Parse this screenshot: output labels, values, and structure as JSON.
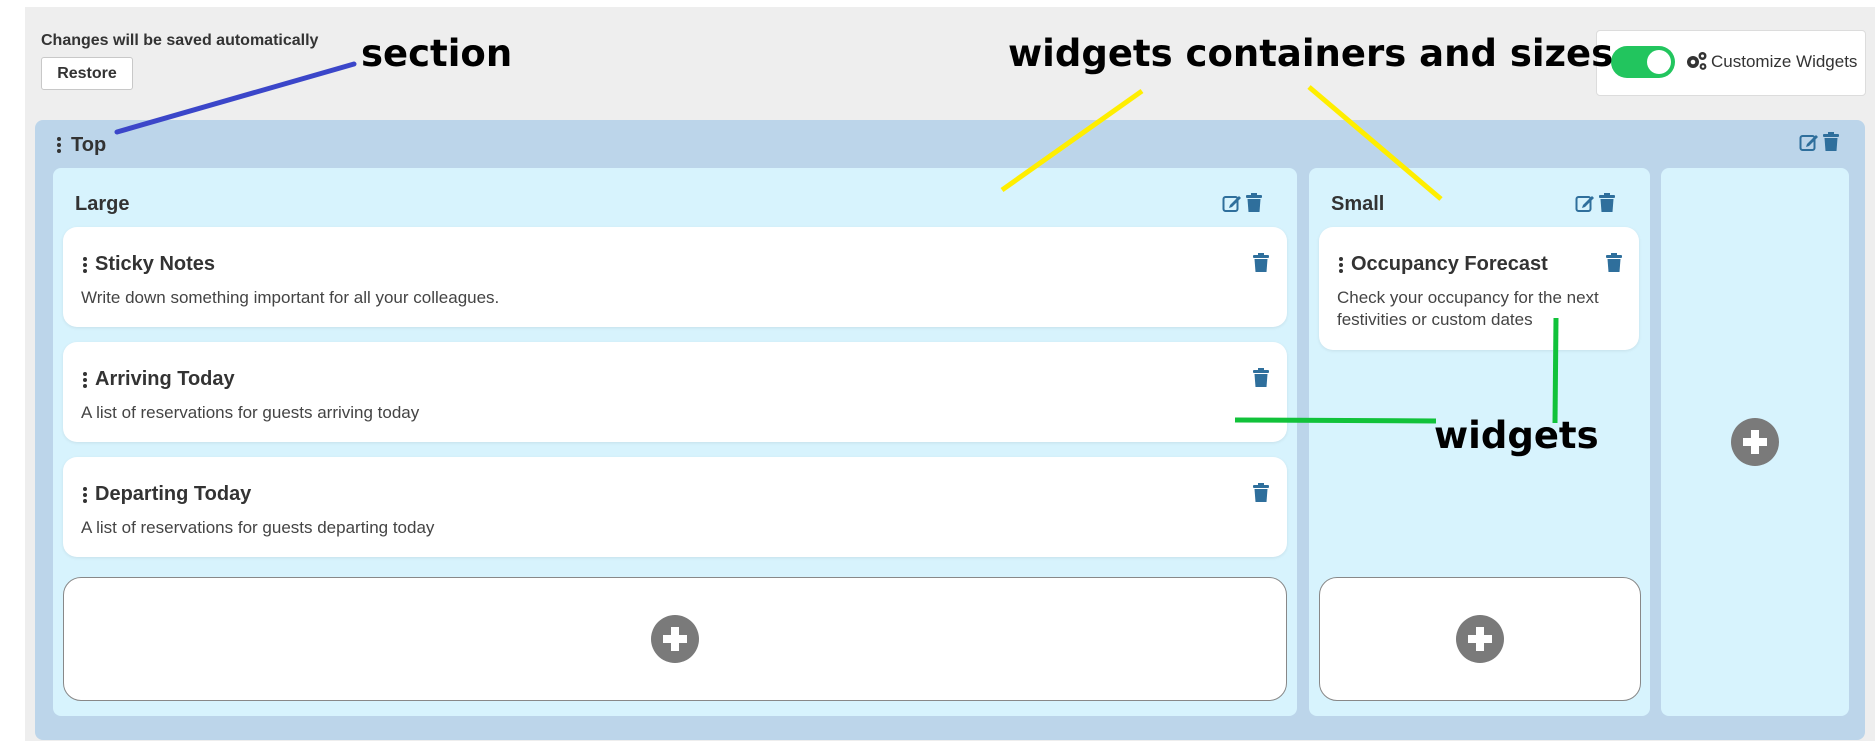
{
  "header": {
    "autosave_note": "Changes will be saved automatically",
    "restore_label": "Restore",
    "customize_label": "Customize Widgets",
    "customize_enabled": true
  },
  "section": {
    "title": "Top",
    "containers": [
      {
        "title": "Large",
        "widgets": [
          {
            "title": "Sticky Notes",
            "description": "Write down something important for all your colleagues."
          },
          {
            "title": "Arriving Today",
            "description": "A list of reservations for guests arriving today"
          },
          {
            "title": "Departing Today",
            "description": "A list of reservations for guests departing today"
          }
        ]
      },
      {
        "title": "Small",
        "widgets": [
          {
            "title": "Occupancy Forecast",
            "description_lines": [
              "Check your occupancy for the next",
              "festivities or custom dates"
            ]
          }
        ]
      }
    ]
  },
  "annotations": {
    "section": "section",
    "containers": "widgets containers and sizes",
    "widgets": "widgets"
  },
  "colors": {
    "toggle_on": "#22c55e",
    "section_bg": "#bcd5ea",
    "container_bg": "#d7f3fd",
    "icon_blue": "#2f6f9c",
    "annot_blue": "#3b46c9",
    "annot_yellow": "#ffee00",
    "annot_green": "#11c23a"
  },
  "icons": [
    "drag-handle-icon",
    "edit-icon",
    "trash-icon",
    "plus-icon",
    "gear-icon"
  ]
}
